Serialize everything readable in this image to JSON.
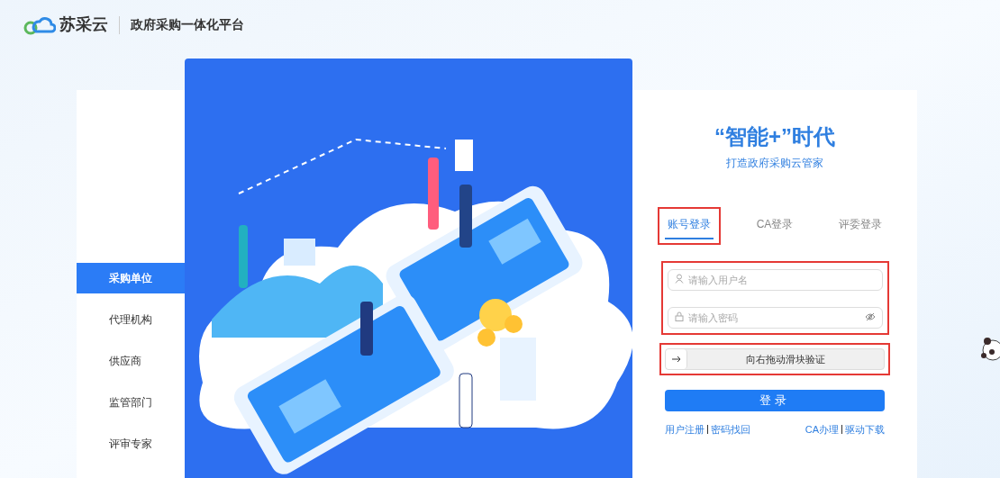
{
  "header": {
    "brand": "苏采云",
    "platform": "政府采购一体化平台"
  },
  "sidebar": {
    "items": [
      {
        "label": "采购单位",
        "selected": true
      },
      {
        "label": "代理机构",
        "selected": false
      },
      {
        "label": "供应商",
        "selected": false
      },
      {
        "label": "监管部门",
        "selected": false
      },
      {
        "label": "评审专家",
        "selected": false
      }
    ]
  },
  "login": {
    "title": "“智能+”时代",
    "subtitle": "打造政府采购云管家",
    "tabs": [
      {
        "label": "账号登录",
        "selected": true,
        "highlighted": true
      },
      {
        "label": "CA登录",
        "selected": false,
        "highlighted": false
      },
      {
        "label": "评委登录",
        "selected": false,
        "highlighted": false
      }
    ],
    "credentials": {
      "highlighted": true,
      "username": {
        "placeholder": "请输入用户名"
      },
      "password": {
        "placeholder": "请输入密码"
      }
    },
    "slider": {
      "label": "向右拖动滑块验证",
      "highlighted": true
    },
    "submit": "登录",
    "links_left": [
      "用户注册",
      "密码找回"
    ],
    "links_right": [
      "CA办理",
      "驱动下载"
    ]
  }
}
